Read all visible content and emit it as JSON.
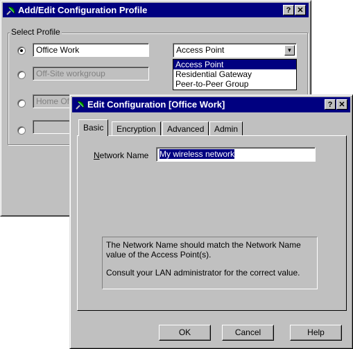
{
  "profile_window": {
    "title": "Add/Edit Configuration Profile",
    "help_btn": "?",
    "close_btn": "✕",
    "group_label": "Select Profile",
    "profiles": [
      {
        "name": "Office Work",
        "selected": true,
        "enabled": true
      },
      {
        "name": "Off-Site workgroup",
        "selected": false,
        "enabled": false
      },
      {
        "name": "Home Of",
        "selected": false,
        "enabled": false
      },
      {
        "name": "",
        "selected": false,
        "enabled": false
      }
    ],
    "mode_select": {
      "value": "Access Point",
      "options": [
        "Access Point",
        "Residential Gateway",
        "Peer-to-Peer Group"
      ],
      "highlighted": "Access Point"
    }
  },
  "edit_window": {
    "title": "Edit Configuration [Office Work]",
    "help_btn": "?",
    "close_btn": "✕",
    "tabs": [
      "Basic",
      "Encryption",
      "Advanced",
      "Admin"
    ],
    "active_tab": "Basic",
    "network_name_label_prefix": "N",
    "network_name_label_rest": "etwork Name",
    "network_name_value": "My wireless network",
    "info_line1": "The Network Name should match the Network Name value of the Access Point(s).",
    "info_line2": "Consult your LAN administrator for the correct value.",
    "buttons": {
      "ok": "OK",
      "cancel": "Cancel",
      "help": "Help"
    }
  },
  "colors": {
    "titlebar": "#000080",
    "face": "#c0c0c0",
    "selection": "#000080"
  },
  "icons": {
    "app_icon": "satellite-dish-icon"
  }
}
